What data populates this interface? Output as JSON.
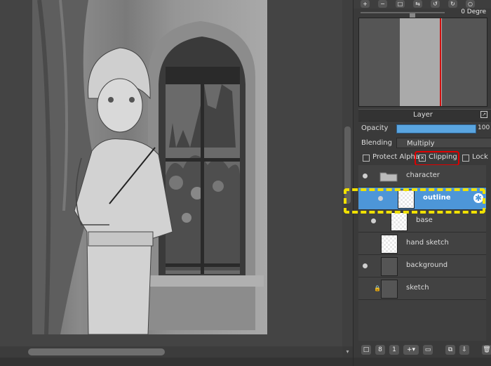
{
  "navigator": {
    "rotation_label": "0 Degre",
    "toolbar_icons": [
      "zoom-in-icon",
      "zoom-out-icon",
      "fit-icon",
      "flip-icon",
      "rotate-left-icon",
      "rotate-right-icon",
      "reset-icon"
    ]
  },
  "layer_panel": {
    "title": "Layer",
    "opacity_label": "Opacity",
    "opacity_value": "100",
    "opacity_percent": 100,
    "blending_label": "Blending",
    "blending_value": "Multiply",
    "protect_alpha_label": "Protect Alpha",
    "clipping_label": "Clipping",
    "clipping_checked": true,
    "lock_label": "Lock",
    "layers": [
      {
        "name": "character",
        "type": "folder",
        "visible": true
      },
      {
        "name": "outline",
        "type": "layer",
        "visible": true,
        "selected": true
      },
      {
        "name": "base",
        "type": "layer",
        "visible": true
      },
      {
        "name": "hand sketch",
        "type": "layer",
        "visible": false
      },
      {
        "name": "background",
        "type": "layer",
        "visible": true
      },
      {
        "name": "sketch",
        "type": "layer",
        "visible": false,
        "locked": true
      }
    ]
  },
  "colors": {
    "selection_blue": "#4d96d8",
    "highlight_red": "#e00000",
    "annotation_yellow": "#f0e000"
  }
}
